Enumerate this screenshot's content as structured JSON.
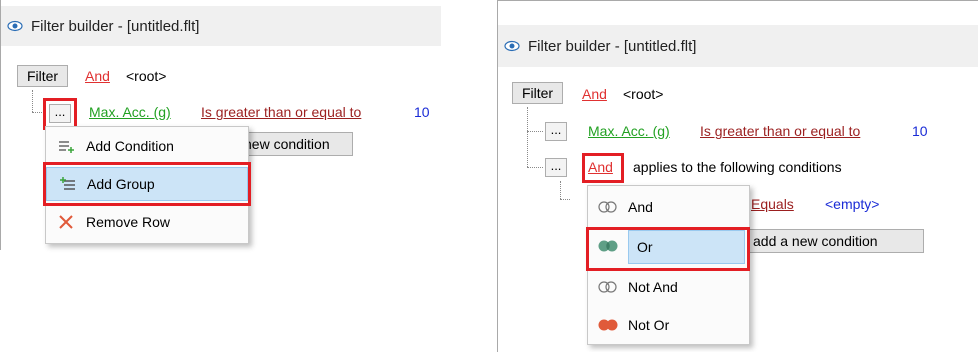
{
  "app": {
    "title": "Filter builder - [untitled.flt]"
  },
  "tree": {
    "filter_button": "Filter",
    "root_operator": "And",
    "root_label": "<root>",
    "ellipsis": "...",
    "field": "Max. Acc. (g)",
    "operator": "Is greater than or equal to",
    "value": "10",
    "add_condition_partial": "new condition",
    "group_operator": "And",
    "group_description": "applies to the following conditions",
    "sub_operator": "Equals",
    "sub_value": "<empty>",
    "add_condition_partial_right": "add a new condition"
  },
  "row_menu": {
    "items": [
      {
        "label": "Add Condition",
        "icon": "add-condition-icon"
      },
      {
        "label": "Add Group",
        "icon": "add-group-icon",
        "selected": true
      },
      {
        "label": "Remove Row",
        "icon": "remove-icon"
      }
    ]
  },
  "group_menu": {
    "items": [
      {
        "label": "And",
        "icon": "and-icon"
      },
      {
        "label": "Or",
        "icon": "or-icon",
        "selected": true
      },
      {
        "label": "Not And",
        "icon": "not-and-icon"
      },
      {
        "label": "Not Or",
        "icon": "not-or-icon"
      }
    ]
  },
  "colors": {
    "highlight": "#e31e24",
    "link_red": "#e03131",
    "link_green": "#22a122",
    "value_blue": "#1a2bd6",
    "selection": "#cce4f7"
  }
}
